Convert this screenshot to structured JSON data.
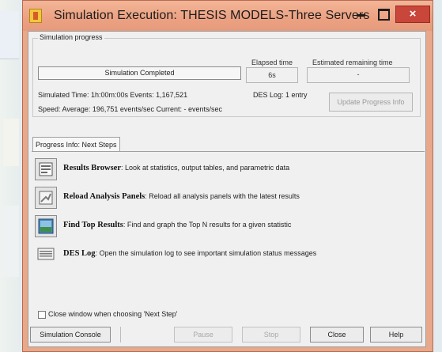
{
  "window": {
    "title": "Simulation Execution: THESIS MODELS-Three Servers",
    "close_glyph": "×"
  },
  "progress": {
    "group_label": "Simulation progress",
    "status": "Simulation Completed",
    "elapsed_label": "Elapsed time",
    "elapsed_value": "6s",
    "remaining_label": "Estimated remaining time",
    "remaining_value": "-",
    "simulated_time": "Simulated Time: 1h:00m:00s  Events: 1,167,521",
    "speed": "Speed: Average: 196,751 events/sec  Current: - events/sec",
    "des_log_entry": "DES Log: 1 entry",
    "update_button": "Update Progress Info"
  },
  "tab_label": "Progress Info: Next Steps",
  "steps": [
    {
      "title": "Results Browser",
      "text": ": Look at statistics, output tables, and parametric data",
      "icon": "results-browser-icon"
    },
    {
      "title": "Reload Analysis Panels",
      "text": ": Reload all analysis panels with the latest results",
      "icon": "reload-panels-icon"
    },
    {
      "title": "Find Top Results",
      "text": ": Find and graph the Top N results for a given statistic",
      "icon": "top-results-icon"
    },
    {
      "title": "DES Log",
      "text": ": Open the simulation log to see important simulation status messages",
      "icon": "des-log-icon"
    }
  ],
  "checkbox_label": "Close window when choosing 'Next Step'",
  "buttons": {
    "console": "Simulation Console",
    "pause": "Pause",
    "stop": "Stop",
    "close": "Close",
    "help": "Help"
  },
  "colors": {
    "titlebar": "#eba182",
    "close_button": "#c9463a",
    "panel": "#f0f0f0"
  }
}
